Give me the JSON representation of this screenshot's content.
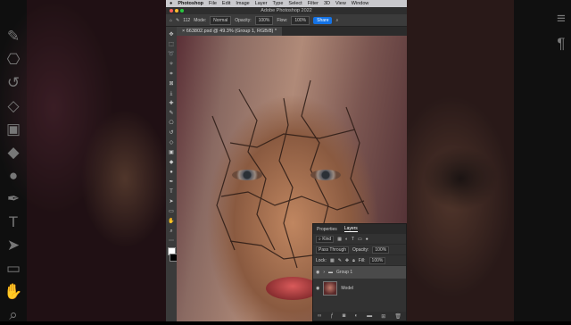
{
  "menubar": {
    "apple": "",
    "items": [
      "Photoshop",
      "File",
      "Edit",
      "Image",
      "Layer",
      "Type",
      "Select",
      "Filter",
      "3D",
      "View",
      "Window"
    ]
  },
  "window": {
    "title": "Adobe Photoshop 2022"
  },
  "options": {
    "mode_label": "Mode:",
    "mode_value": "Normal",
    "opacity_label": "Opacity:",
    "opacity_value": "100%",
    "flow_label": "Flow:",
    "flow_value": "100%",
    "brush_size": "112",
    "share_label": "Share"
  },
  "document": {
    "tab": "663802.psd @ 49.3% (Group 1, RGB/8) *"
  },
  "layers_panel": {
    "tabs": [
      "Properties",
      "Layers"
    ],
    "active_tab": "Layers",
    "filter_kind": "Kind",
    "blend_mode": "Pass Through",
    "opacity_label": "Opacity:",
    "opacity_value": "100%",
    "lock_label": "Lock:",
    "fill_label": "Fill:",
    "fill_value": "100%",
    "layers": [
      {
        "name": "Group 1",
        "type": "group",
        "selected": true
      },
      {
        "name": "Model",
        "type": "pixel",
        "selected": false
      }
    ]
  },
  "colors": {
    "accent": "#1473e6",
    "panel": "#323232",
    "toolbar": "#3a3a3a"
  }
}
